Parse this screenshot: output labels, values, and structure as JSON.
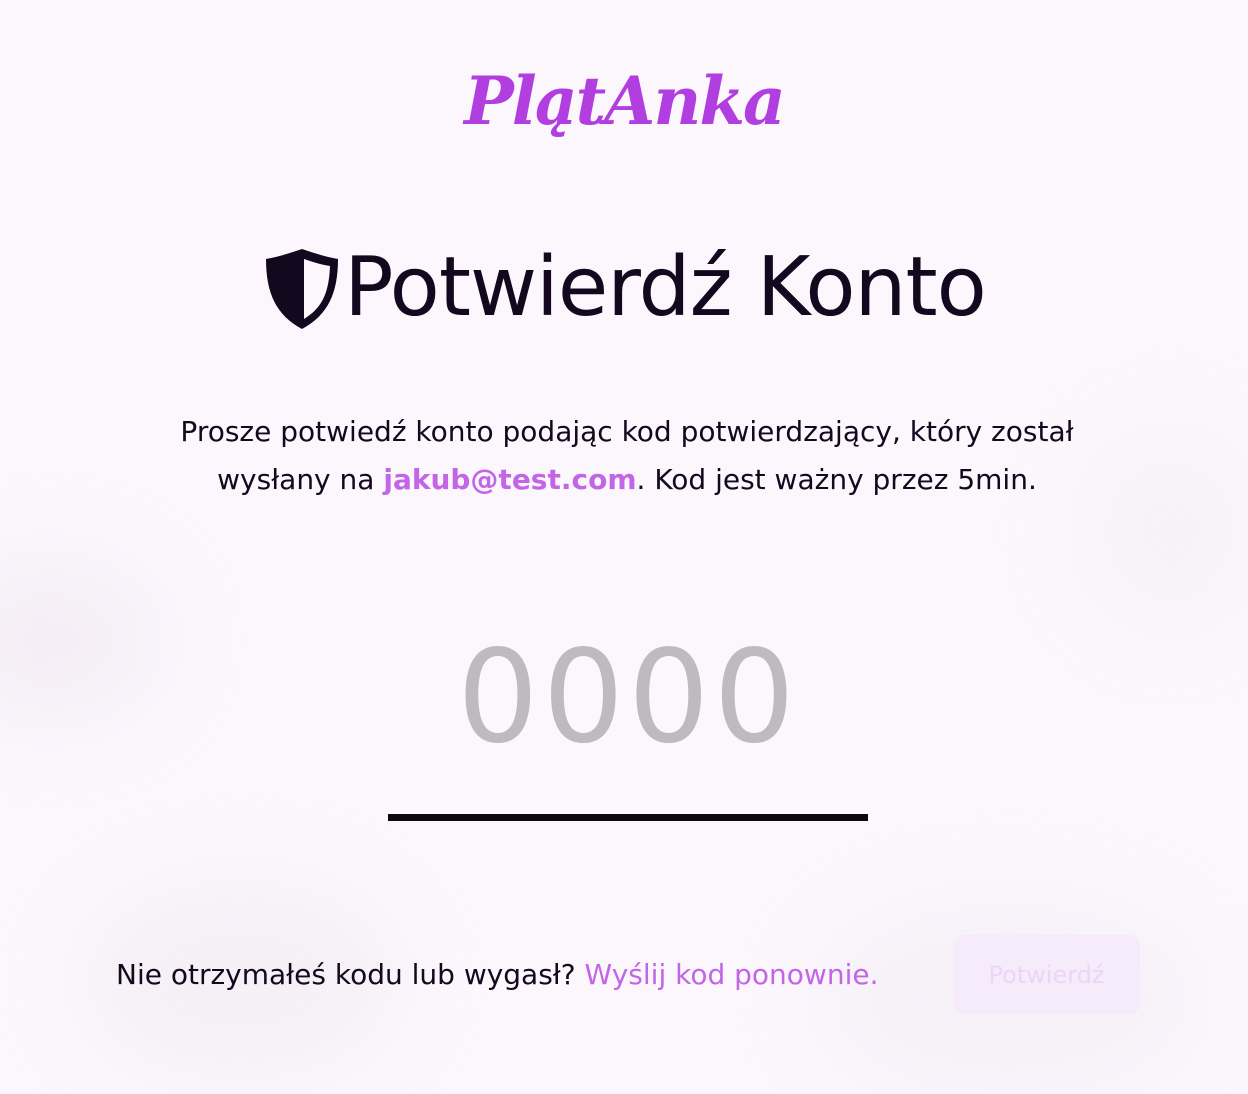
{
  "brand": {
    "logo_text": "PlątAnka",
    "accent_color": "#b13fdf",
    "link_color": "#c266e6"
  },
  "header": {
    "icon": "shield-icon",
    "title": "Potwierdź Konto"
  },
  "description": {
    "part1": "Prosze potwiedź konto podając kod potwierdzający, który został wysłany na ",
    "email": "jakub@test.com",
    "part2": ". Kod jest ważny przez 5min."
  },
  "code_input": {
    "placeholder": "0000",
    "value": ""
  },
  "footer": {
    "resend_prompt": "Nie otrzymałeś kodu lub wygasł? ",
    "resend_link": "Wyślij kod ponownie.",
    "confirm_button": "Potwierdź"
  }
}
